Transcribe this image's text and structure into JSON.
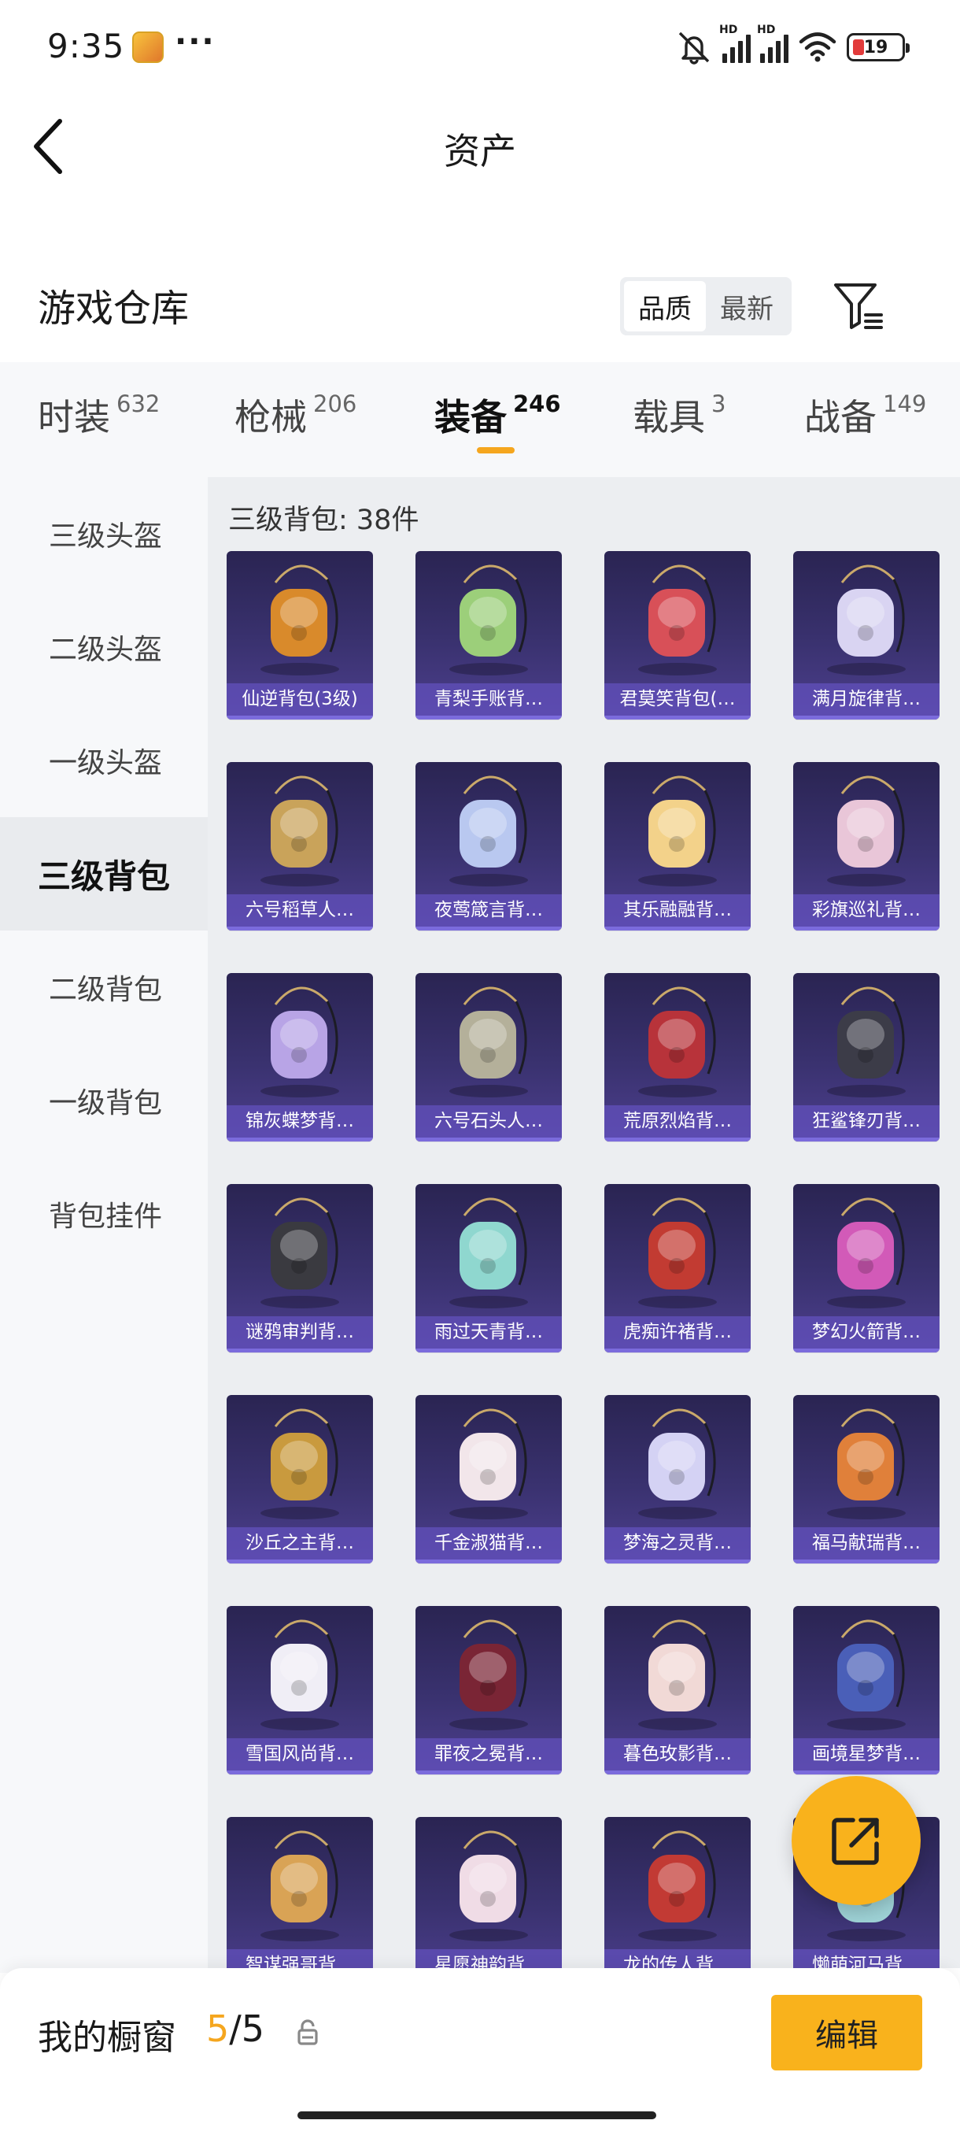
{
  "status": {
    "time": "9:35",
    "dots": "···",
    "battery": "19",
    "hd1": "HD",
    "hd2": "HD"
  },
  "header": {
    "title": "资产"
  },
  "warehouse": {
    "title": "游戏仓库",
    "sort_options": [
      "品质",
      "最新"
    ],
    "active_sort": "品质"
  },
  "tabs": [
    {
      "label": "时装",
      "count": "632"
    },
    {
      "label": "枪械",
      "count": "206"
    },
    {
      "label": "装备",
      "count": "246",
      "active": true
    },
    {
      "label": "载具",
      "count": "3"
    },
    {
      "label": "战备",
      "count": "149"
    }
  ],
  "sidebar": [
    {
      "label": "三级头盔"
    },
    {
      "label": "二级头盔"
    },
    {
      "label": "一级头盔"
    },
    {
      "label": "三级背包",
      "active": true
    },
    {
      "label": "二级背包"
    },
    {
      "label": "一级背包"
    },
    {
      "label": "背包挂件"
    }
  ],
  "grid": {
    "section_label": "三级背包: 38件",
    "items": [
      {
        "name": "仙逆背包(3级)",
        "accent": "#d98a2b"
      },
      {
        "name": "青梨手账背…",
        "accent": "#9ccf7a"
      },
      {
        "name": "君莫笑背包(…",
        "accent": "#d85058"
      },
      {
        "name": "满月旋律背…",
        "accent": "#d9d4f2"
      },
      {
        "name": "六号稻草人…",
        "accent": "#c9a35a"
      },
      {
        "name": "夜莺箴言背…",
        "accent": "#b9c8f0"
      },
      {
        "name": "其乐融融背…",
        "accent": "#f3d28a"
      },
      {
        "name": "彩旗巡礼背…",
        "accent": "#e9c6d8"
      },
      {
        "name": "锦灰蝶梦背…",
        "accent": "#b8a4e6"
      },
      {
        "name": "六号石头人…",
        "accent": "#b4b09a"
      },
      {
        "name": "荒原烈焰背…",
        "accent": "#b8333a"
      },
      {
        "name": "狂鲨锋刃背…",
        "accent": "#3c3c48"
      },
      {
        "name": "谜鸦审判背…",
        "accent": "#3a3a40"
      },
      {
        "name": "雨过天青背…",
        "accent": "#8fd7cf"
      },
      {
        "name": "虎痴许褚背…",
        "accent": "#c23b32"
      },
      {
        "name": "梦幻火箭背…",
        "accent": "#d25ab8"
      },
      {
        "name": "沙丘之主背…",
        "accent": "#c99a3e"
      },
      {
        "name": "千金淑猫背…",
        "accent": "#f2e6ea"
      },
      {
        "name": "梦海之灵背…",
        "accent": "#d4d2f4"
      },
      {
        "name": "福马献瑞背…",
        "accent": "#e0803a"
      },
      {
        "name": "雪国风尚背…",
        "accent": "#f0eef6"
      },
      {
        "name": "罪夜之冕背…",
        "accent": "#7a2535"
      },
      {
        "name": "暮色玫影背…",
        "accent": "#f1d9d6"
      },
      {
        "name": "画境星梦背…",
        "accent": "#4a5fb8"
      },
      {
        "name": "智谋强哥背…",
        "accent": "#d9a355"
      },
      {
        "name": "星愿神韵背…",
        "accent": "#f0dce6"
      },
      {
        "name": "龙的传人背…",
        "accent": "#c23a34"
      },
      {
        "name": "懒萌河马背…",
        "accent": "#9ed2d6"
      }
    ]
  },
  "bottom": {
    "showcase_label": "我的橱窗",
    "showcase_current": "5",
    "showcase_total": "/5",
    "edit_label": "编辑"
  },
  "colors": {
    "accent": "#f9b21c",
    "card_bg": "#3a3270",
    "card_label": "#6250be"
  }
}
